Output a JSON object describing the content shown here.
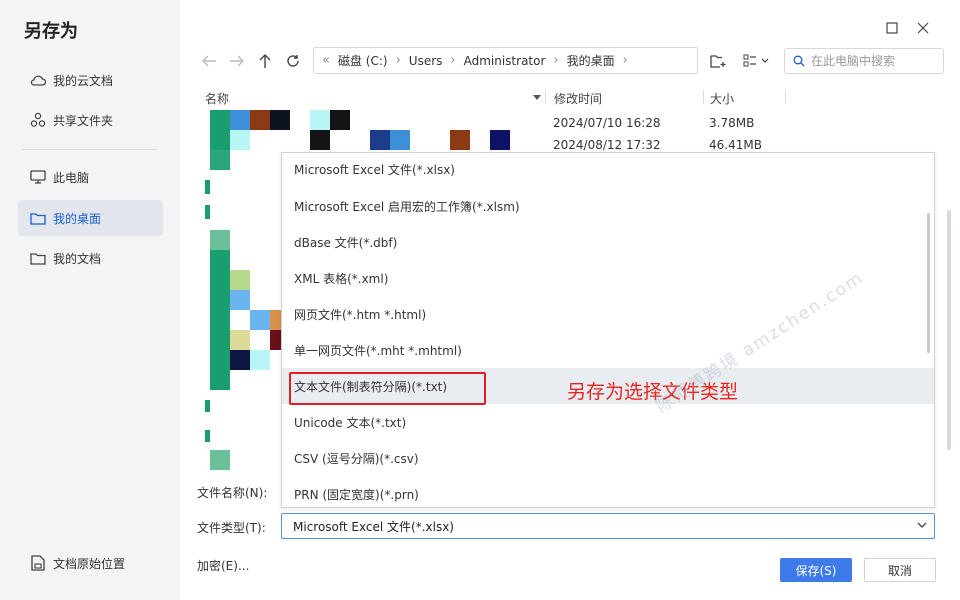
{
  "window": {
    "title": "另存为"
  },
  "sidebar": {
    "items": [
      {
        "label": "我的云文档",
        "icon": "cloud-icon"
      },
      {
        "label": "共享文件夹",
        "icon": "share-icon"
      },
      {
        "label": "此电脑",
        "icon": "computer-icon"
      },
      {
        "label": "我的桌面",
        "icon": "folder-icon",
        "active": true
      },
      {
        "label": "我的文档",
        "icon": "folder-icon"
      }
    ],
    "bottom": {
      "label": "文档原始位置",
      "icon": "document-location-icon"
    }
  },
  "nav": {
    "path": [
      "磁盘 (C:)",
      "Users",
      "Administrator",
      "我的桌面"
    ],
    "search_placeholder": "在此电脑中搜索"
  },
  "columns": {
    "name": "名称",
    "modified": "修改时间",
    "size": "大小"
  },
  "files": [
    {
      "modified": "2024/07/10 16:28",
      "size": "3.78MB"
    },
    {
      "modified": "2024/08/12 17:32",
      "size": "46.41MB"
    }
  ],
  "form": {
    "filename_label": "文件名称(N):",
    "filetype_label": "文件类型(T):",
    "filetype_value": "Microsoft Excel 文件(*.xlsx)",
    "encrypt_label": "加密(E)...",
    "save_label": "保存(S)",
    "cancel_label": "取消"
  },
  "dropdown": {
    "options": [
      "Microsoft Excel 文件(*.xlsx)",
      "Microsoft Excel 启用宏的工作簿(*.xlsm)",
      "dBase 文件(*.dbf)",
      "XML 表格(*.xml)",
      "网页文件(*.htm *.html)",
      "单一网页文件(*.mht *.mhtml)",
      "文本文件(制表符分隔)(*.txt)",
      "Unicode 文本(*.txt)",
      "CSV (逗号分隔)(*.csv)",
      "PRN (固定宽度)(*.prn)"
    ],
    "highlighted_index": 6
  },
  "annotation": {
    "text": "另存为选择文件类型"
  },
  "watermark": {
    "text": "陈师傅跨境 amzchen.com"
  },
  "colors": {
    "accent": "#3d7bea",
    "annotation": "#e8261e",
    "sidebar_bg": "#f3f4f6"
  }
}
